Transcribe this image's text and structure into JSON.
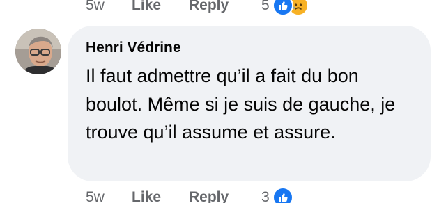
{
  "top_actions": {
    "time": "5w",
    "like_label": "Like",
    "reply_label": "Reply",
    "reaction_count": "5",
    "reactions": [
      "like-icon",
      "sad-icon"
    ]
  },
  "comment": {
    "author": "Henri Védrine",
    "text": "Il faut admettre qu’il a fait du bon boulot. Même si je suis de gauche, je trouve qu’il assume et assure."
  },
  "bottom_actions": {
    "time": "5w",
    "like_label": "Like",
    "reply_label": "Reply",
    "reaction_count": "3",
    "reactions": [
      "like-icon"
    ]
  },
  "colors": {
    "bubble": "#f0f2f5",
    "meta_text": "#65676b",
    "like_blue": "#1877f2",
    "sad_yellow": "#f7b125"
  }
}
